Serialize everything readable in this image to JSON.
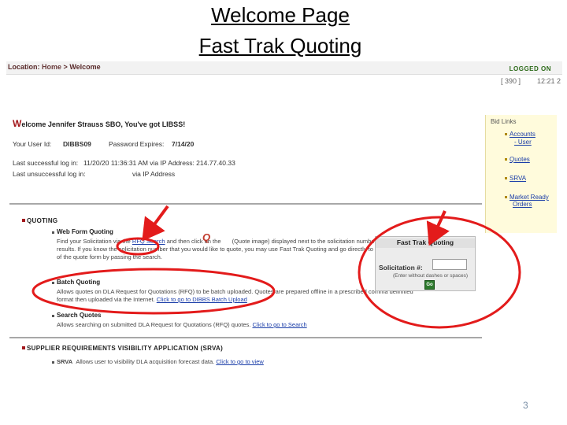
{
  "slide": {
    "title_line1": "Welcome Page",
    "title_line2": "Fast Trak Quoting",
    "page_number": "3"
  },
  "location_bar": {
    "prefix": "Location:",
    "home": "Home",
    "sep": ">",
    "current": "Welcome",
    "logged_on": "LOGGED ON"
  },
  "user_status": {
    "left": "[ 390 ]",
    "right": "12:21 2"
  },
  "sidebar": {
    "header": "Bid Links",
    "items": [
      "Accounts",
      "- User",
      "Quotes",
      "SRVA",
      "Market Ready",
      "Orders"
    ]
  },
  "welcome": {
    "initial": "W",
    "rest": "elcome Jennifer Strauss SBO, You've got LIBSS!"
  },
  "info": {
    "userid_label": "Your User Id:",
    "userid_value": "DIBBS09",
    "pwd_label": "Password Expires:",
    "pwd_value": "7/14/20",
    "lastlogin_label": "Last successful log in:",
    "lastlogin_value": "11/20/20   11:36:31 AM   via IP Address:  214.77.40.33",
    "lastfail_label": "Last unsuccessful log in:",
    "lastfail_value": "via IP Address"
  },
  "quoting": {
    "header": "QUOTING",
    "web_form": {
      "title": "Web Form Quoting",
      "line1_a": "Find your Solicitation via the",
      "line1_link": "RFQ Search",
      "line1_b": "and then click on the",
      "line1_c": "(Quote image) displayed next to the solicitation number on the search",
      "line2": "results. If you know the solicitation number that you would like to quote, you may use Fast Trak Quoting and go directly to step one",
      "line3": "of the quote form by passing the search."
    },
    "batch": {
      "title": "Batch Quoting",
      "line1": "Allows quotes on DLA Request for Quotations (RFQ) to be batch uploaded. Quotes are prepared offline in a prescribed comma delimited",
      "line2_a": "format then uploaded via the Internet.",
      "line2_link": "Click to go to DIBBS Batch Upload"
    },
    "search": {
      "title": "Search Quotes",
      "line1_a": "Allows searching on submitted DLA Request for Quotations (RFQ) quotes.",
      "line1_link": "Click to go to Search"
    }
  },
  "srva": {
    "header": "SUPPLIER REQUIREMENTS VISIBILITY APPLICATION (SRVA)",
    "item_title": "SRVA",
    "item_text_a": "Allows user to visibility DLA acquisition forecast data.",
    "item_link": "Click to go to view"
  },
  "fast_trak": {
    "header": "Fast Trak Quoting",
    "label": "Solicitation #:",
    "hint": "(Enter without dashes or spaces)",
    "go": "Go"
  },
  "colors": {
    "annotation_red": "#e31b1b",
    "link_blue": "#1a3da8",
    "brand_red": "#a3171b",
    "sidebar_yellow": "#fffbdc"
  }
}
